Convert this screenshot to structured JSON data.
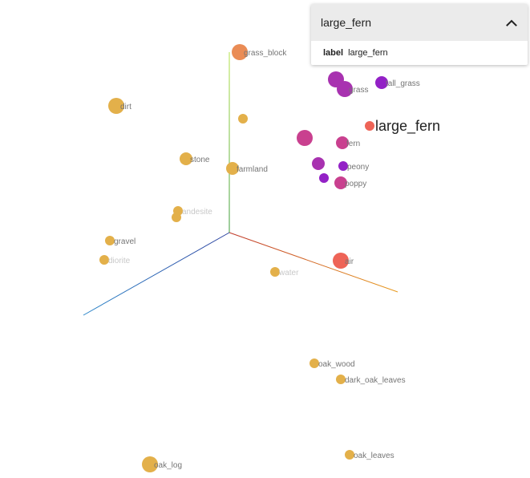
{
  "card": {
    "title": "large_fern",
    "property_key": "label",
    "property_value": "large_fern"
  },
  "icons": {
    "collapse": "chevron-up-icon"
  },
  "colors": {
    "yellow": "#e3b04a",
    "orange": "#ea8c55",
    "red": "#ee6457",
    "magenta": "#c9408f",
    "purple": "#a832b0",
    "violet": "#9321c6",
    "axis_x": "#d9661e",
    "axis_y": "#8bd13d",
    "axis_z": "#2a63c9"
  },
  "points": [
    {
      "label": "grass_block",
      "color": "orange",
      "size": "large"
    },
    {
      "label": "dirt",
      "color": "yellow",
      "size": "large"
    },
    {
      "label": "",
      "color": "yellow",
      "size": "small"
    },
    {
      "label": "stone",
      "color": "yellow",
      "size": "medium"
    },
    {
      "label": "farmland",
      "color": "yellow",
      "size": "medium"
    },
    {
      "label": "andesite",
      "color": "yellow",
      "size": "small",
      "faint": true
    },
    {
      "label": "",
      "color": "yellow",
      "size": "small"
    },
    {
      "label": "gravel",
      "color": "yellow",
      "size": "small"
    },
    {
      "label": "diorite",
      "color": "yellow",
      "size": "small",
      "faint": true
    },
    {
      "label": "water",
      "color": "yellow",
      "size": "small",
      "faint": true
    },
    {
      "label": "oak_wood",
      "color": "yellow",
      "size": "small"
    },
    {
      "label": "dark_oak_leaves",
      "color": "yellow",
      "size": "small"
    },
    {
      "label": "oak_log",
      "color": "yellow",
      "size": "large"
    },
    {
      "label": "oak_leaves",
      "color": "yellow",
      "size": "small"
    },
    {
      "label": "air",
      "color": "red",
      "size": "large"
    },
    {
      "label": "",
      "color": "purple",
      "size": "large"
    },
    {
      "label": "grass",
      "color": "purple",
      "size": "large"
    },
    {
      "label": "tall_grass",
      "color": "violet",
      "size": "medium"
    },
    {
      "label": "large_fern",
      "color": "red",
      "size": "small",
      "highlight": true
    },
    {
      "label": "",
      "color": "magenta",
      "size": "large"
    },
    {
      "label": "fern",
      "color": "magenta",
      "size": "medium"
    },
    {
      "label": "",
      "color": "purple",
      "size": "medium"
    },
    {
      "label": "peony",
      "color": "violet",
      "size": "small"
    },
    {
      "label": "poppy",
      "color": "magenta",
      "size": "medium"
    },
    {
      "label": "",
      "color": "violet",
      "size": "small"
    }
  ]
}
